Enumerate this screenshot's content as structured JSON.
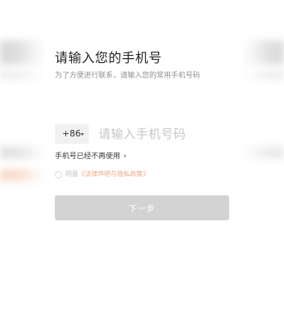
{
  "modal": {
    "title": "请输入您的手机号",
    "subtitle": "为了方便进行联系，请输入您的常用手机号码"
  },
  "phone": {
    "country_code": "+86",
    "placeholder": "请输入手机号码"
  },
  "switch_number": {
    "label": "手机号已经不再使用"
  },
  "agreement": {
    "prefix": "同意",
    "policy_link": "《法律声明与隐私政策》"
  },
  "next_button": {
    "label": "下一步"
  },
  "colors": {
    "button_disabled": "#d3d3d3",
    "link_accent": "#f0a77f",
    "title_text": "#222222",
    "subtitle_text": "#8f8f8f"
  },
  "icons": {
    "country_dropdown": "caret-down-icon",
    "switch_number": "chevron-right-icon",
    "agreement": "radio-check-icon"
  }
}
